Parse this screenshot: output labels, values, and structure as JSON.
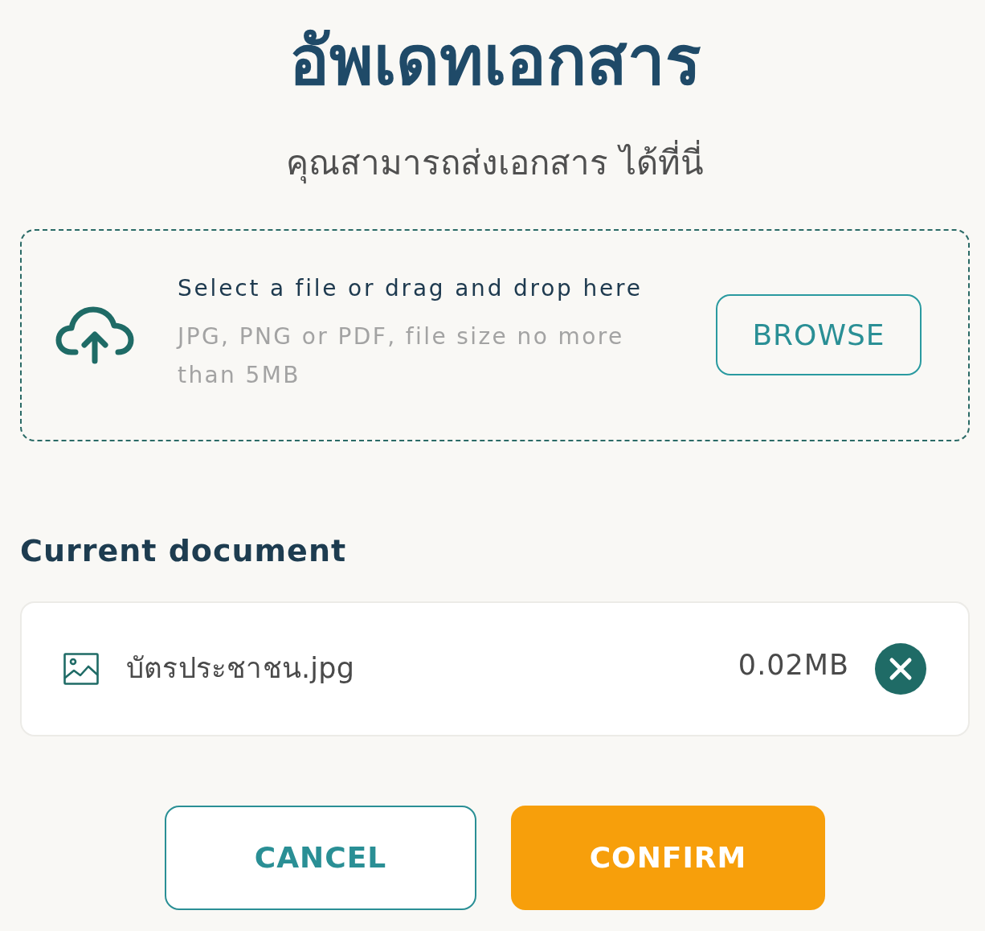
{
  "title": "อัพเดทเอกสาร",
  "subtitle": "คุณสามารถส่งเอกสาร ได้ที่นี่",
  "upload_area": {
    "prompt": "Select a file or drag and drop here",
    "hint": "JPG, PNG or PDF, file size no more than 5MB",
    "browse_button": "BROWSE"
  },
  "current_document": {
    "heading": "Current document",
    "file": {
      "name": "บัตรประชาชน.jpg",
      "size": "0.02MB"
    }
  },
  "buttons": [
    {
      "label": "CANCEL",
      "kind": "secondary"
    },
    {
      "label": "CONFIRM",
      "kind": "primary"
    }
  ]
}
